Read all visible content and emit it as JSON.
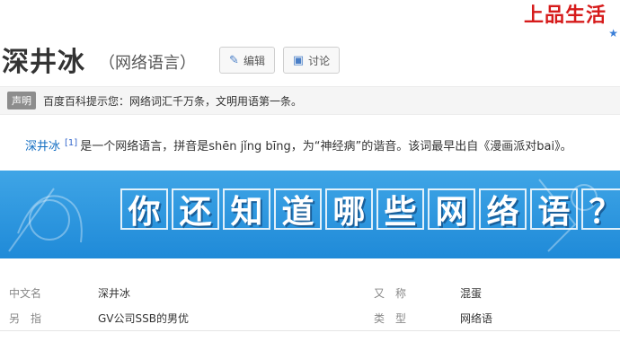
{
  "brand": {
    "text": "上品生活",
    "color": "#d61b1b"
  },
  "header": {
    "title": "深井冰",
    "subtitle": "（网络语言）",
    "edit_label": "编辑",
    "discuss_label": "讨论"
  },
  "notice": {
    "badge": "声明",
    "text": "百度百科提示您：网络词汇千万条，文明用语第一条。"
  },
  "intro": {
    "term": "深井冰",
    "ref": "[1]",
    "text": "是一个网络语言，拼音是shēn jǐng bīng，为“神经病”的谐音。该词最早出自《漫画派对bai》。"
  },
  "banner": {
    "chars": [
      "你",
      "还",
      "知",
      "道",
      "哪",
      "些",
      "网",
      "络",
      "语",
      "？"
    ],
    "bg_color": "#2b96de"
  },
  "info": {
    "rows": [
      {
        "label1": "中文名",
        "value1": "深井冰",
        "label2": "又　称",
        "value2": "混蛋"
      },
      {
        "label1": "另　指",
        "value1": "GV公司SSB的男优",
        "label2": "类　型",
        "value2": "网络语"
      }
    ]
  },
  "colors": {
    "link": "#136ec2",
    "accent": "#4a7fc7"
  },
  "icons": {
    "edit": "pencil-icon",
    "discuss": "chat-icon",
    "brand_star": "star-icon"
  }
}
